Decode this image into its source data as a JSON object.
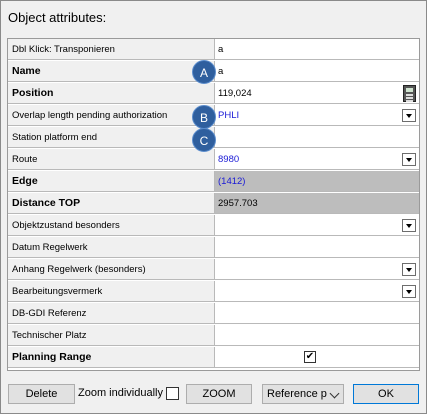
{
  "title": "Object attributes:",
  "rows": [
    {
      "label": "Dbl Klick: Transponieren",
      "value": "a"
    },
    {
      "label": "Name",
      "value": "a"
    },
    {
      "label": "Position",
      "value": "119,024"
    },
    {
      "label": "Overlap length pending authorization",
      "value": "PHLI"
    },
    {
      "label": "Station platform end",
      "value": ""
    },
    {
      "label": "Route",
      "value": "8980"
    },
    {
      "label": "Edge",
      "value": "(1412)"
    },
    {
      "label": "Distance TOP",
      "value": "2957.703"
    },
    {
      "label": "Objektzustand besonders",
      "value": ""
    },
    {
      "label": "Datum Regelwerk",
      "value": ""
    },
    {
      "label": "Anhang Regelwerk (besonders)",
      "value": ""
    },
    {
      "label": "Bearbeitungsvermerk",
      "value": ""
    },
    {
      "label": "DB-GDI Referenz",
      "value": ""
    },
    {
      "label": "Technischer Platz",
      "value": ""
    },
    {
      "label": "Planning Range",
      "value": "✔"
    }
  ],
  "badges": [
    "A",
    "B",
    "C"
  ],
  "footer": {
    "delete_label": "Delete",
    "zoom_individually_label": "Zoom individually",
    "zoom_label": "ZOOM",
    "reference_label": "Reference p",
    "ok_label": "OK"
  },
  "colors": {
    "badge": "#2f5f9e",
    "readonly_bg": "#bdbdbd",
    "link_text": "#1a1ad6"
  }
}
